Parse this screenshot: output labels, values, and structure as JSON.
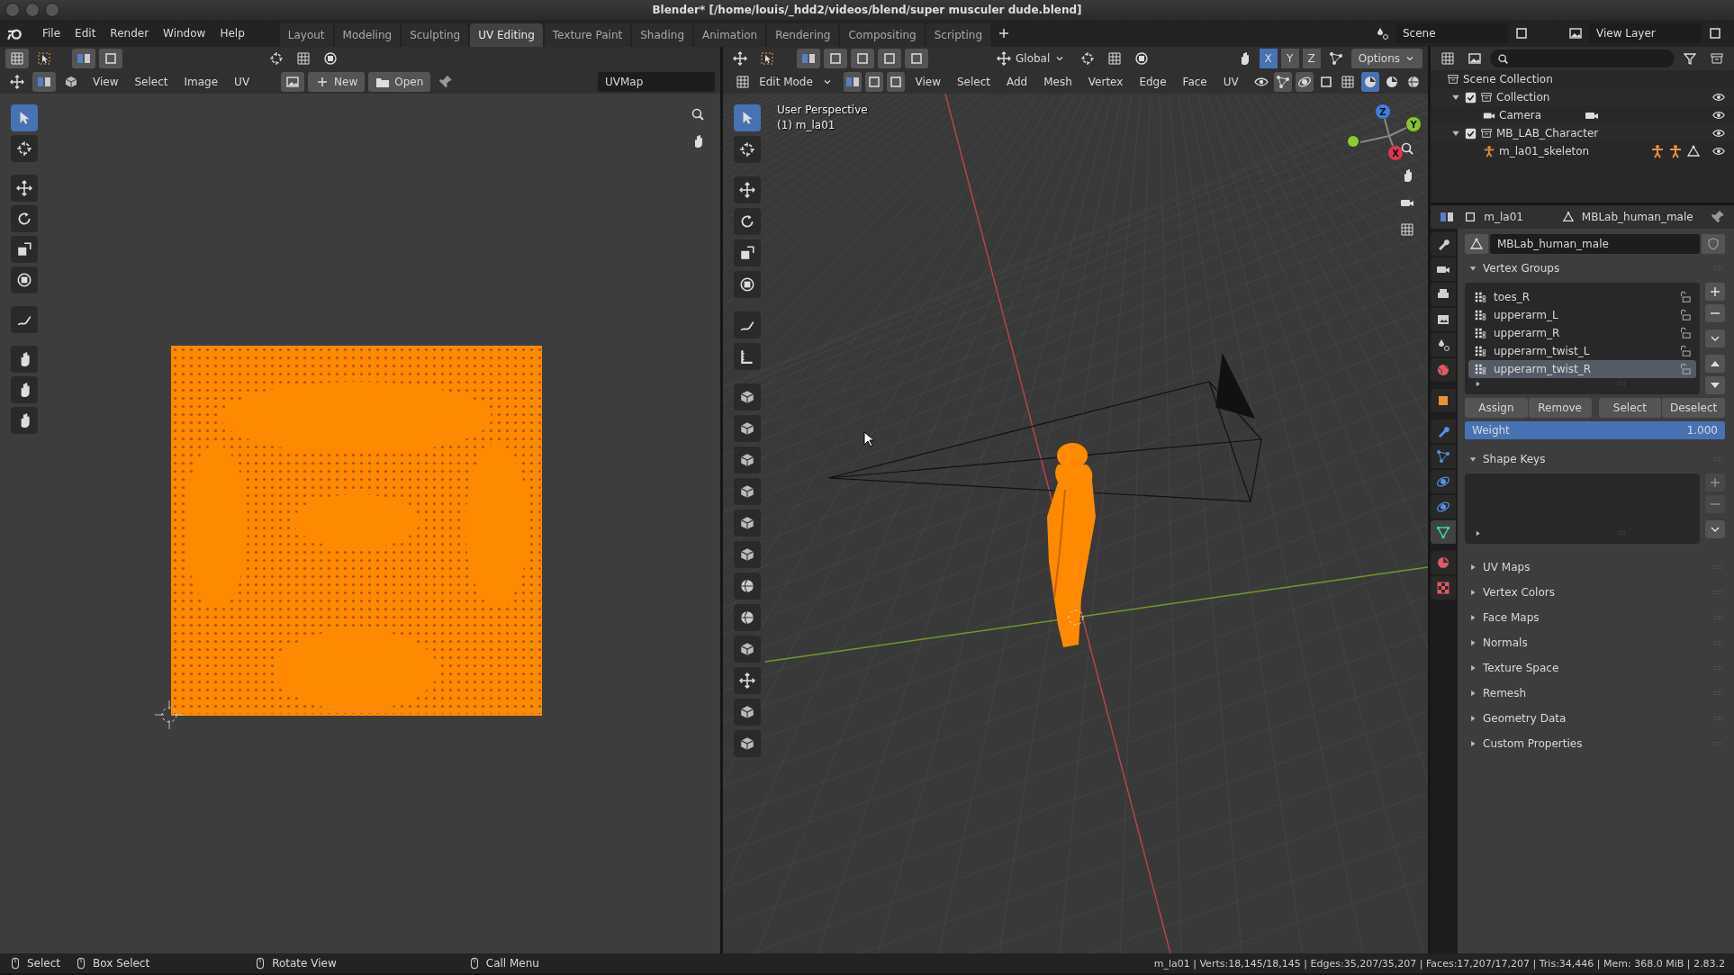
{
  "window": {
    "title": "Blender* [/home/louis/_hdd2/videos/blend/super musculer dude.blend]"
  },
  "menu": [
    "File",
    "Edit",
    "Render",
    "Window",
    "Help"
  ],
  "workspaces": [
    {
      "label": "Layout",
      "selected": false
    },
    {
      "label": "Modeling",
      "selected": false
    },
    {
      "label": "Sculpting",
      "selected": false
    },
    {
      "label": "UV Editing",
      "selected": true
    },
    {
      "label": "Texture Paint",
      "selected": false
    },
    {
      "label": "Shading",
      "selected": false
    },
    {
      "label": "Animation",
      "selected": false
    },
    {
      "label": "Rendering",
      "selected": false
    },
    {
      "label": "Compositing",
      "selected": false
    },
    {
      "label": "Scripting",
      "selected": false
    }
  ],
  "scene": {
    "label": "Scene"
  },
  "view_layer": {
    "label": "View Layer"
  },
  "uv_editor": {
    "menu": [
      "View",
      "Select",
      "Image",
      "UV"
    ],
    "new_button": "New",
    "open_button": "Open",
    "uv_map": "UVMap",
    "tools": [
      {
        "selected": true
      },
      {
        "selected": false
      },
      {
        "selected": false
      },
      {
        "selected": false
      },
      {
        "selected": false
      },
      {
        "selected": false
      },
      {
        "selected": false
      },
      {
        "selected": false
      },
      {
        "selected": false
      },
      {
        "selected": false
      }
    ]
  },
  "viewport": {
    "mode": "Edit Mode",
    "orientation": "Global",
    "options": "Options",
    "mirror_axes": [
      {
        "label": "X",
        "selected": true
      },
      {
        "label": "Y",
        "selected": false
      },
      {
        "label": "Z",
        "selected": false
      }
    ],
    "menu": [
      "View",
      "Select",
      "Add",
      "Mesh",
      "Vertex",
      "Edge",
      "Face",
      "UV"
    ],
    "perspective": "User Perspective",
    "object": "(1) m_la01",
    "gizmo_axes": [
      "Z",
      "Y",
      "X"
    ],
    "tools": [
      {
        "selected": true
      },
      {
        "selected": false
      },
      {
        "selected": false
      },
      {
        "selected": false
      },
      {
        "selected": false
      },
      {
        "selected": false
      },
      {
        "selected": false
      },
      {
        "selected": false
      },
      {
        "selected": false
      },
      {
        "selected": false
      },
      {
        "selected": false
      },
      {
        "selected": false
      },
      {
        "selected": false
      },
      {
        "selected": false
      },
      {
        "selected": false
      },
      {
        "selected": false
      },
      {
        "selected": false
      },
      {
        "selected": false
      },
      {
        "selected": false
      },
      {
        "selected": false
      }
    ]
  },
  "outliner": {
    "root": "Scene Collection",
    "items": [
      {
        "label": "Collection",
        "checked": true,
        "expanded": true,
        "children": [
          {
            "label": "Camera"
          }
        ]
      },
      {
        "label": "MB_LAB_Character",
        "checked": true,
        "expanded": true,
        "children": [
          {
            "label": "m_la01_skeleton"
          }
        ]
      }
    ]
  },
  "properties": {
    "tabs": [
      {
        "color": "#d0d0d0",
        "selected": false
      },
      {
        "color": "#d0d0d0",
        "selected": false
      },
      {
        "color": "#d0d0d0",
        "selected": false
      },
      {
        "color": "#d0d0d0",
        "selected": false
      },
      {
        "color": "#d0d0d0",
        "selected": false
      },
      {
        "color": "#e05a63",
        "selected": false
      },
      {
        "color": "#e8913a",
        "selected": false
      },
      {
        "color": "#5b8fe0",
        "selected": false
      },
      {
        "color": "#5b8fe0",
        "selected": false
      },
      {
        "color": "#5b8fe0",
        "selected": false
      },
      {
        "color": "#5b8fe0",
        "selected": false
      },
      {
        "color": "#2fd9a0",
        "selected": true
      },
      {
        "color": "#e05a63",
        "selected": false
      },
      {
        "color": "#e05a63",
        "selected": false
      }
    ],
    "object": "m_la01",
    "data": "MBLab_human_male",
    "mesh": "MBLab_human_male",
    "vertex_groups": {
      "title": "Vertex Groups",
      "expanded": true,
      "items": [
        {
          "name": "toes_R",
          "selected": false
        },
        {
          "name": "upperarm_L",
          "selected": false
        },
        {
          "name": "upperarm_R",
          "selected": false
        },
        {
          "name": "upperarm_twist_L",
          "selected": false
        },
        {
          "name": "upperarm_twist_R",
          "selected": true
        }
      ],
      "buttons": [
        "Assign",
        "Remove",
        "Select",
        "Deselect"
      ],
      "weight": {
        "label": "Weight",
        "value": "1.000",
        "level": 1
      }
    },
    "shape_keys": {
      "title": "Shape Keys",
      "expanded": true
    },
    "panels": [
      {
        "title": "UV Maps",
        "expanded": false
      },
      {
        "title": "Vertex Colors",
        "expanded": false
      },
      {
        "title": "Face Maps",
        "expanded": false
      },
      {
        "title": "Normals",
        "expanded": false
      },
      {
        "title": "Texture Space",
        "expanded": false
      },
      {
        "title": "Remesh",
        "expanded": false
      },
      {
        "title": "Geometry Data",
        "expanded": false
      },
      {
        "title": "Custom Properties",
        "expanded": false
      }
    ]
  },
  "status_bar": {
    "hints": [
      "Select",
      "Box Select",
      "Rotate View",
      "Call Menu"
    ],
    "stats": "m_la01 | Verts:18,145/18,145 | Edges:35,207/35,207 | Faces:17,207/17,207 | Tris:34,446 | Mem: 368.0 MiB | 2.83.2"
  }
}
